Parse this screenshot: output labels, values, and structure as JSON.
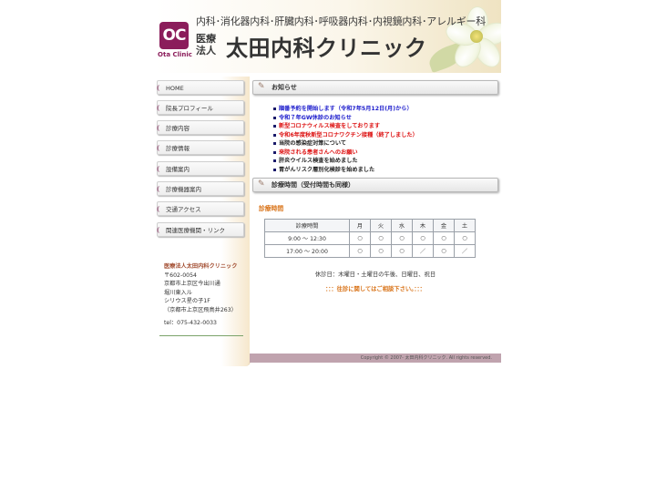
{
  "header": {
    "logo_text": "OC",
    "logo_subtitle": "Ota Clinic",
    "specialties": "内科･消化器内科･肝臓内科･呼吸器内科･内視鏡内科･アレルギー科",
    "corporation": "医療法人",
    "clinic_name": "太田内科クリニック"
  },
  "nav": [
    {
      "label": "HOME"
    },
    {
      "label": "院長プロフィール"
    },
    {
      "label": "診療内容"
    },
    {
      "label": "診療情報"
    },
    {
      "label": "設備案内"
    },
    {
      "label": "診療機器案内"
    },
    {
      "label": "交通アクセス"
    },
    {
      "label": "関連医療機関・リンク"
    }
  ],
  "address": {
    "name": "医療法人太田内科クリニック",
    "postal": "〒602-0054",
    "line1": "京都市上京区今出川通",
    "line2": "堀川東入ル",
    "line3": "シリウス星の子1F",
    "line4": "（京都市上京区飛鳥井263）",
    "tel": "tel：075-432-0033"
  },
  "news": {
    "title": "お知らせ",
    "items": [
      {
        "text": "順番予約を開始します（令和7年5月12日(月)から）",
        "color": "#1a1acc"
      },
      {
        "text": "令和７年GW休診のお知らせ",
        "color": "#1a1acc"
      },
      {
        "text": "新型コロナウィルス検査をしております",
        "color": "#dd1111"
      },
      {
        "text": "令和6年度秋新型コロナワクチン接種（終了しました）",
        "color": "#dd1111"
      },
      {
        "text": "当院の感染症対策について",
        "color": "#222222"
      },
      {
        "text": "来院される患者さんへのお願い",
        "color": "#dd1111"
      },
      {
        "text": "肝炎ウイルス検査を始めました",
        "color": "#222222"
      },
      {
        "text": "胃がんリスク層別化検診を始めました",
        "color": "#222222"
      }
    ]
  },
  "hours": {
    "section_title": "診療時間（受付時間も同様）",
    "subtitle": "診療時間",
    "headers": [
      "診療時間",
      "月",
      "火",
      "水",
      "木",
      "金",
      "土"
    ],
    "rows": [
      [
        "9:00 〜 12:30",
        "○",
        "○",
        "○",
        "○",
        "○",
        "○"
      ],
      [
        "17:00 〜 20:00",
        "○",
        "○",
        "○",
        "／",
        "○",
        "／"
      ]
    ],
    "closed_note": "休診日：木曜日・土曜日の午後、日曜日、祝日",
    "contact_note": "：：：往診に関してはご相談下さい。：：："
  },
  "footer": {
    "copyright": "Copyright © 2007- 太田内科クリニック. All rights reserved."
  },
  "colors": {
    "brand": "#8b1d5b",
    "accent_orange": "#d9741a",
    "footer_bar": "#c0a3ae"
  }
}
